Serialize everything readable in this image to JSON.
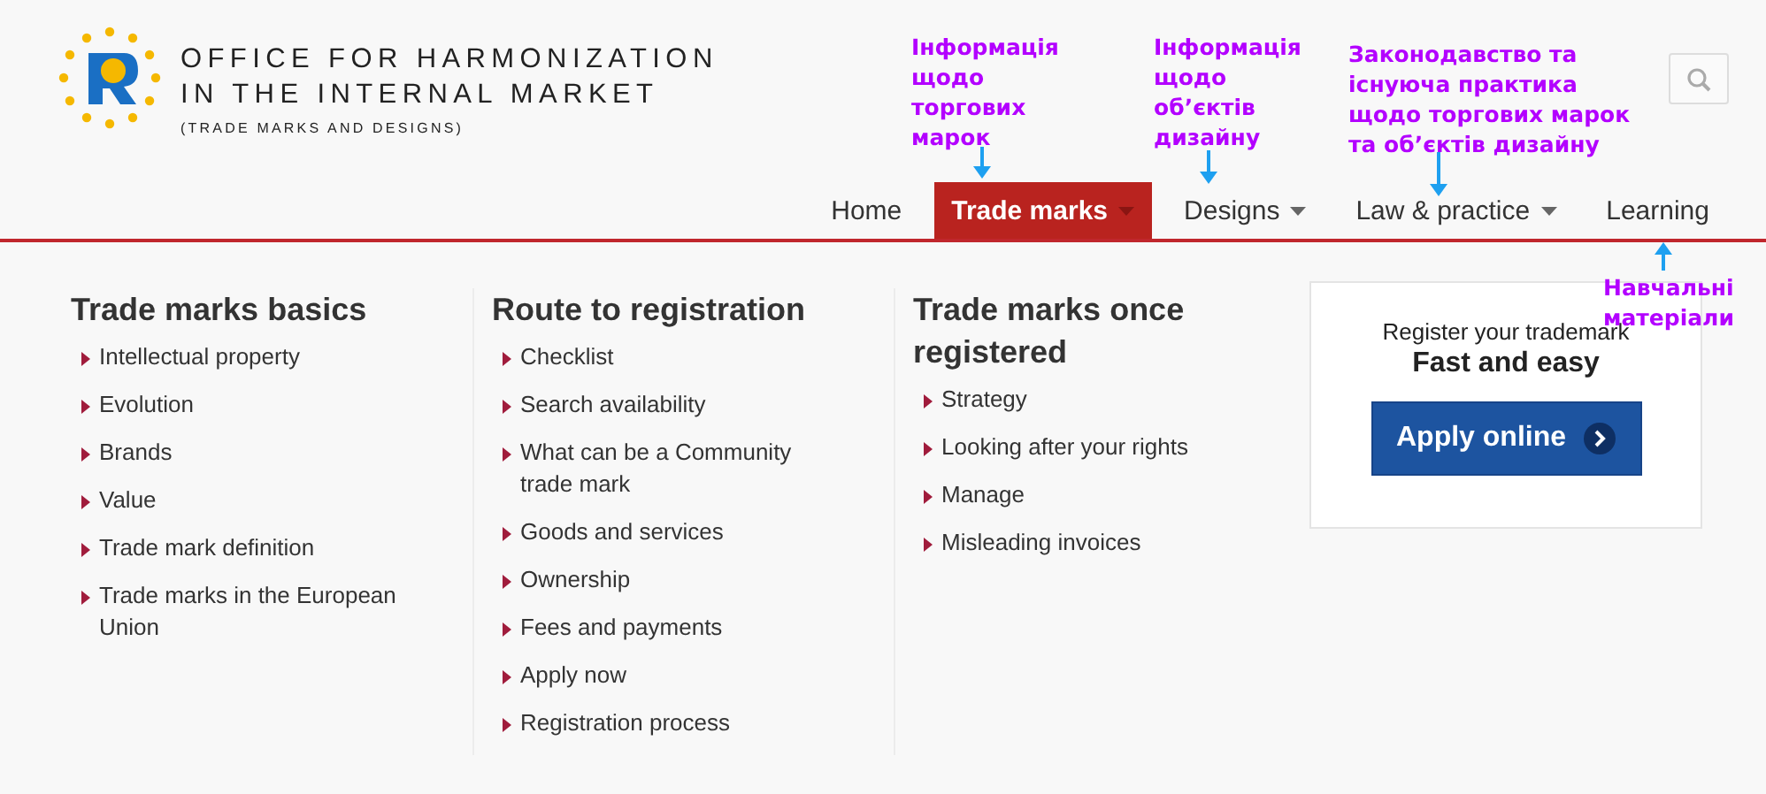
{
  "header": {
    "logo_lines": [
      "OFFICE FOR HARMONIZATION",
      "IN THE INTERNAL MARKET"
    ],
    "logo_subline": "(TRADE MARKS AND DESIGNS)"
  },
  "nav": [
    {
      "label": "Home",
      "selected": false,
      "dropdown": false
    },
    {
      "label": "Trade marks",
      "selected": true,
      "dropdown": true
    },
    {
      "label": "Designs",
      "selected": false,
      "dropdown": true
    },
    {
      "label": "Law & practice",
      "selected": false,
      "dropdown": true
    },
    {
      "label": "Learning",
      "selected": false,
      "dropdown": false
    }
  ],
  "columns": [
    {
      "title": "Trade marks basics",
      "items": [
        "Intellectual property",
        "Evolution",
        "Brands",
        "Value",
        "Trade mark definition",
        "Trade marks in the European Union"
      ]
    },
    {
      "title": "Route to registration",
      "items": [
        "Checklist",
        "Search availability",
        "What can be a Community trade mark",
        "Goods and services",
        "Ownership",
        "Fees and payments",
        "Apply now",
        "Registration process"
      ]
    },
    {
      "title": "Trade marks once registered",
      "items": [
        "Strategy",
        "Looking after your rights",
        "Manage",
        "Misleading invoices"
      ]
    }
  ],
  "promo": {
    "subtitle": "Register your trademark",
    "title": "Fast and easy",
    "button": "Apply online"
  },
  "annotations": [
    {
      "lines": [
        "Інформація",
        "щодо",
        "торгових",
        "марок"
      ],
      "kind": "down"
    },
    {
      "lines": [
        "Інформація",
        "щодо",
        "об’єктів",
        "дизайну"
      ],
      "kind": "down"
    },
    {
      "lines": [
        "Законодавство та",
        "існуюча практика",
        "щодо торгових марок",
        "та об’єктів дизайну"
      ],
      "kind": "down"
    },
    {
      "lines": [
        "Навчальні",
        "матеріали"
      ],
      "kind": "up"
    }
  ]
}
